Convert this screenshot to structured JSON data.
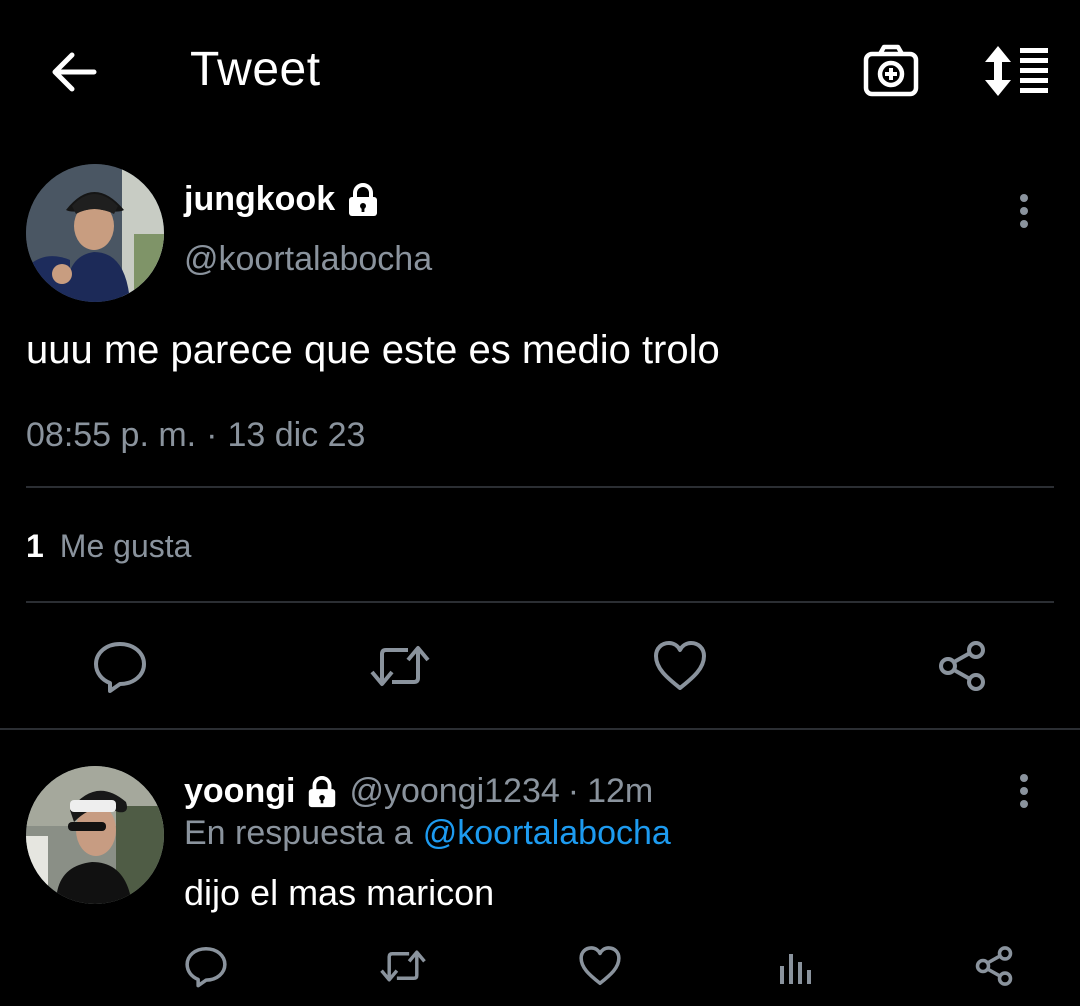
{
  "header": {
    "title": "Tweet",
    "icons": [
      "arrow-left-icon",
      "camera-add-icon",
      "sort-list-icon"
    ]
  },
  "tweet": {
    "display_name": "jungkook",
    "handle": "@koortalabocha",
    "protected_icon": "lock-icon",
    "text": "uuu me parece que este es medio trolo",
    "time": "08:55 p. m.",
    "separator": "·",
    "date": "13 dic 23",
    "likes_count": "1",
    "likes_label": "Me gusta"
  },
  "reply": {
    "display_name": "yoongi",
    "handle": "@yoongi1234",
    "separator": "·",
    "age": "12m",
    "in_reply_label": "En respuesta a",
    "in_reply_handle": "@koortalabocha",
    "text": "dijo el mas maricon"
  },
  "colors": {
    "background": "#000000",
    "muted_text": "#8a939d",
    "link": "#1d9bf0",
    "divider": "#2b2e33"
  }
}
